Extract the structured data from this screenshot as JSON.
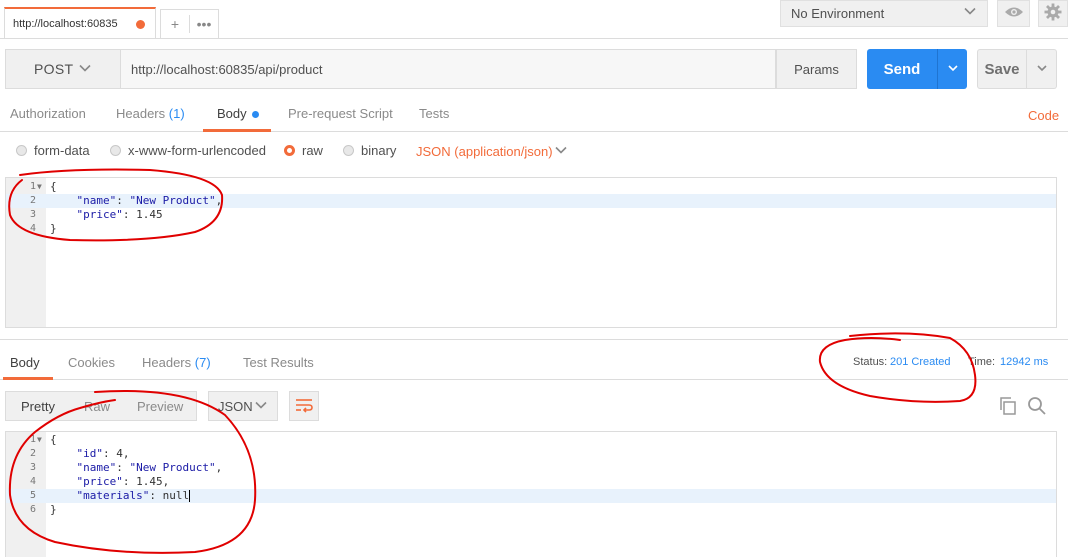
{
  "tab": {
    "title": "http://localhost:60835"
  },
  "environment": {
    "selected": "No Environment"
  },
  "request": {
    "method": "POST",
    "url": "http://localhost:60835/api/product",
    "params_label": "Params",
    "send_label": "Send",
    "save_label": "Save"
  },
  "request_tabs": {
    "authorization": "Authorization",
    "headers": "Headers",
    "headers_count": "(1)",
    "body": "Body",
    "prerequest": "Pre-request Script",
    "tests": "Tests",
    "code": "Code"
  },
  "body_types": {
    "form_data": "form-data",
    "urlencoded": "x-www-form-urlencoded",
    "raw": "raw",
    "binary": "binary",
    "content_type": "JSON (application/json)"
  },
  "request_body": {
    "lines": [
      "1",
      "2",
      "3",
      "4"
    ],
    "open": "{",
    "name_key": "\"name\"",
    "name_value": "\"New Product\"",
    "price_key": "\"price\"",
    "price_value": "1.45",
    "close": "}"
  },
  "response_tabs": {
    "body": "Body",
    "cookies": "Cookies",
    "headers": "Headers",
    "headers_count": "(7)",
    "test_results": "Test Results"
  },
  "response_meta": {
    "status_label": "Status:",
    "status_value": "201 Created",
    "time_label": "Time:",
    "time_value": "12942 ms"
  },
  "response_view": {
    "pretty": "Pretty",
    "raw": "Raw",
    "preview": "Preview",
    "format": "JSON"
  },
  "response_body": {
    "lines": [
      "1",
      "2",
      "3",
      "4",
      "5",
      "6"
    ],
    "open": "{",
    "id_key": "\"id\"",
    "id_value": "4",
    "name_key": "\"name\"",
    "name_value": "\"New Product\"",
    "price_key": "\"price\"",
    "price_value": "1.45",
    "materials_key": "\"materials\"",
    "materials_value": "null",
    "close": "}"
  },
  "colors": {
    "accent": "#f26b3a",
    "primary": "#2a8bf2",
    "annotation": "#e00000"
  }
}
